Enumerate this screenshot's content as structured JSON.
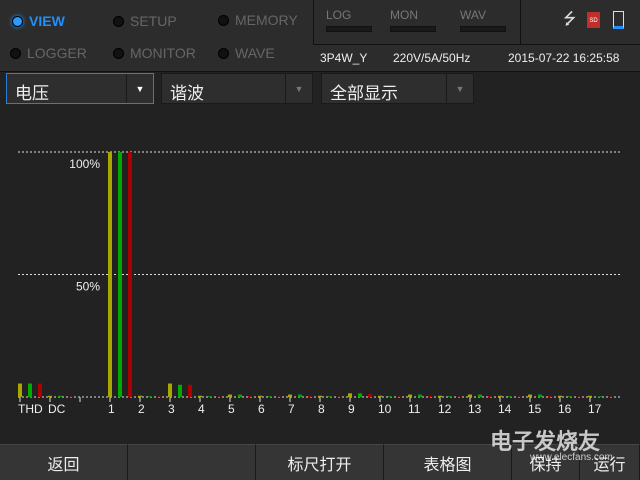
{
  "modes": [
    {
      "label": "VIEW",
      "active": true
    },
    {
      "label": "SETUP",
      "active": false
    },
    {
      "label": "MEMORY",
      "active": false
    },
    {
      "label": "LOGGER",
      "active": false
    },
    {
      "label": "MONITOR",
      "active": false
    },
    {
      "label": "WAVE",
      "active": false
    }
  ],
  "indicators": [
    "LOG",
    "MON",
    "WAV"
  ],
  "status_icons": [
    "usb-icon",
    "sd-card-icon",
    "battery-icon"
  ],
  "info": {
    "wiring": "3P4W_Y",
    "range": "220V/5A/50Hz",
    "datetime": "2015-07-22 16:25:58"
  },
  "selectors": [
    {
      "value": "电压",
      "active": true
    },
    {
      "value": "谐波",
      "active": false
    },
    {
      "value": "全部显示",
      "active": false
    }
  ],
  "colors": {
    "accent": "#1e90ff",
    "phase1": "#a8a800",
    "phase2": "#00aa00",
    "phase3": "#aa0000"
  },
  "chart_data": {
    "type": "bar",
    "ylim": [
      0,
      100
    ],
    "yticks": [
      "100%",
      "50%"
    ],
    "categories": [
      "THD",
      "DC",
      "",
      "1",
      "2",
      "3",
      "4",
      "5",
      "6",
      "7",
      "8",
      "9",
      "10",
      "11",
      "12",
      "13",
      "14",
      "15",
      "16",
      "17"
    ],
    "series": [
      {
        "values": [
          5.5,
          0.5,
          0,
          100,
          0.5,
          5.5,
          0.5,
          1,
          0.5,
          1,
          0.5,
          1.5,
          0.5,
          1,
          0.5,
          1,
          0.5,
          1,
          0.5,
          0.5
        ]
      },
      {
        "values": [
          5.5,
          0.5,
          0,
          100,
          0.3,
          5,
          0.3,
          1,
          0.3,
          1,
          0.3,
          1.5,
          0.3,
          1,
          0.3,
          1,
          0.3,
          1,
          0.3,
          0.3
        ]
      },
      {
        "values": [
          5.5,
          0.2,
          0,
          100,
          0.2,
          5,
          0.2,
          0.5,
          0.2,
          0.5,
          0.2,
          1.2,
          0.2,
          0.5,
          0.2,
          0.5,
          0.2,
          0.5,
          0.2,
          0.2
        ]
      }
    ]
  },
  "buttons": [
    "返回",
    "",
    "标尺打开",
    "表格图",
    "保持",
    "运行"
  ],
  "watermark": {
    "text": "电子发烧友",
    "url": "www.elecfans.com"
  }
}
